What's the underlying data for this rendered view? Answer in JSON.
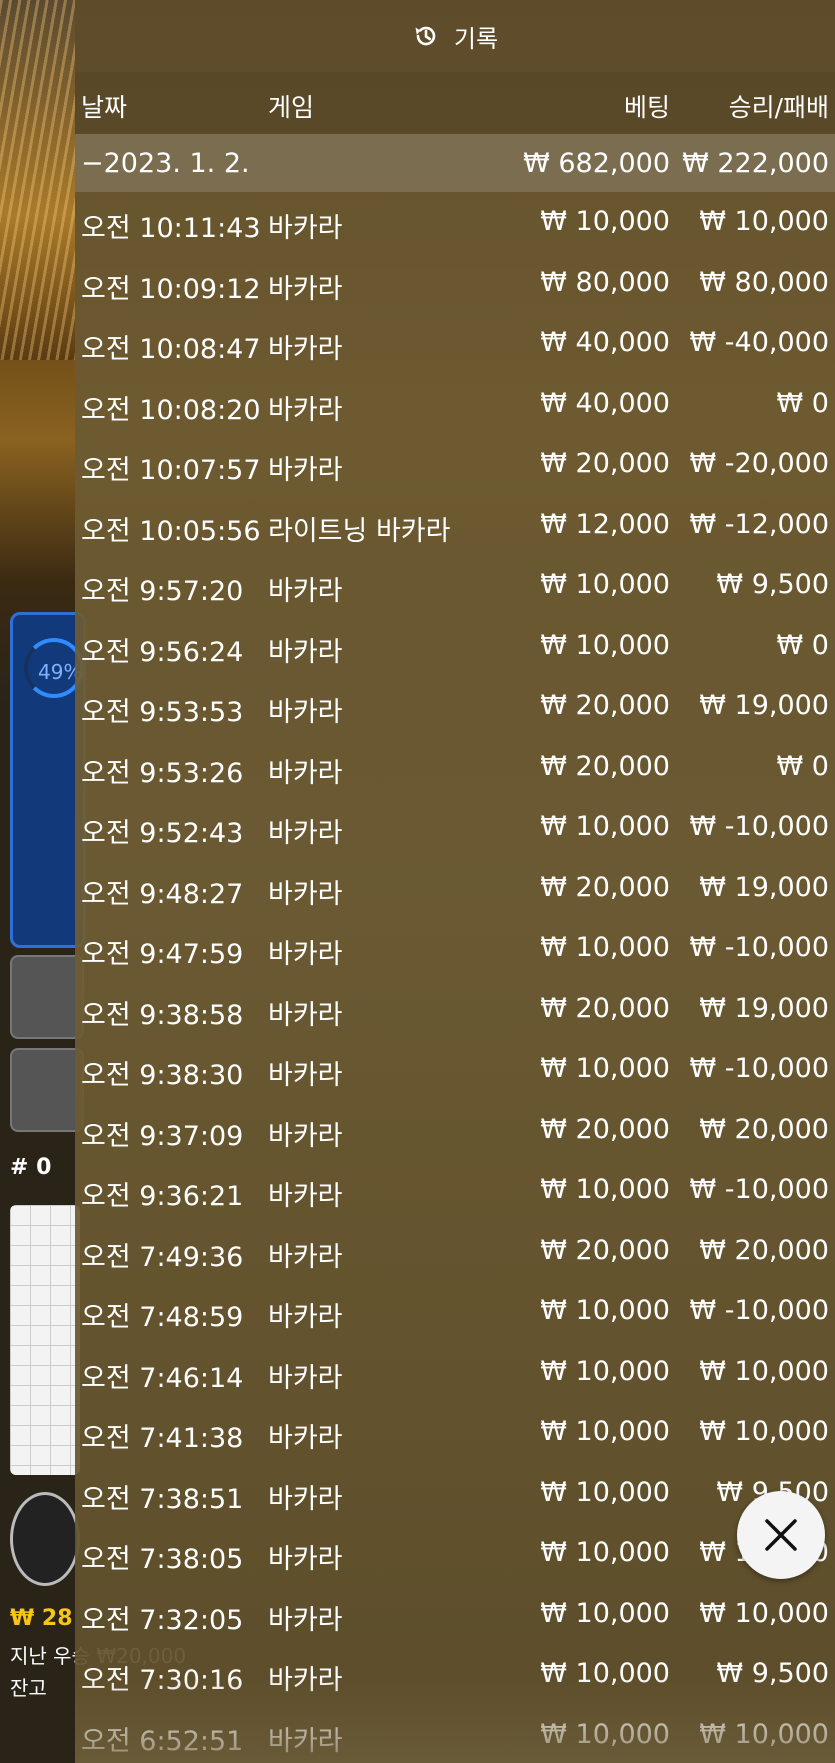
{
  "background": {
    "progress_label": "49%",
    "hash_label": "# 0",
    "balance_line1": "₩ 28",
    "balance_line2": "지난 우승 ₩20,000",
    "balance_line3": "잔고"
  },
  "panel": {
    "title": "기록",
    "icon": "history-icon",
    "columns": {
      "date": "날짜",
      "game": "게임",
      "bet": "베팅",
      "result": "승리/패배"
    },
    "summary": {
      "date": "−2023. 1. 2.",
      "bet": "₩ 682,000",
      "result": "₩ 222,000"
    },
    "rows": [
      {
        "time": "오전 10:11:43",
        "game": "바카라",
        "bet": "₩ 10,000",
        "result": "₩ 10,000"
      },
      {
        "time": "오전 10:09:12",
        "game": "바카라",
        "bet": "₩ 80,000",
        "result": "₩ 80,000"
      },
      {
        "time": "오전 10:08:47",
        "game": "바카라",
        "bet": "₩ 40,000",
        "result": "₩ -40,000"
      },
      {
        "time": "오전 10:08:20",
        "game": "바카라",
        "bet": "₩ 40,000",
        "result": "₩ 0"
      },
      {
        "time": "오전 10:07:57",
        "game": "바카라",
        "bet": "₩ 20,000",
        "result": "₩ -20,000"
      },
      {
        "time": "오전 10:05:56",
        "game": "라이트닝 바카라",
        "bet": "₩ 12,000",
        "result": "₩ -12,000"
      },
      {
        "time": "오전 9:57:20",
        "game": "바카라",
        "bet": "₩ 10,000",
        "result": "₩ 9,500"
      },
      {
        "time": "오전 9:56:24",
        "game": "바카라",
        "bet": "₩ 10,000",
        "result": "₩ 0"
      },
      {
        "time": "오전 9:53:53",
        "game": "바카라",
        "bet": "₩ 20,000",
        "result": "₩ 19,000"
      },
      {
        "time": "오전 9:53:26",
        "game": "바카라",
        "bet": "₩ 20,000",
        "result": "₩ 0"
      },
      {
        "time": "오전 9:52:43",
        "game": "바카라",
        "bet": "₩ 10,000",
        "result": "₩ -10,000"
      },
      {
        "time": "오전 9:48:27",
        "game": "바카라",
        "bet": "₩ 20,000",
        "result": "₩ 19,000"
      },
      {
        "time": "오전 9:47:59",
        "game": "바카라",
        "bet": "₩ 10,000",
        "result": "₩ -10,000"
      },
      {
        "time": "오전 9:38:58",
        "game": "바카라",
        "bet": "₩ 20,000",
        "result": "₩ 19,000"
      },
      {
        "time": "오전 9:38:30",
        "game": "바카라",
        "bet": "₩ 10,000",
        "result": "₩ -10,000"
      },
      {
        "time": "오전 9:37:09",
        "game": "바카라",
        "bet": "₩ 20,000",
        "result": "₩ 20,000"
      },
      {
        "time": "오전 9:36:21",
        "game": "바카라",
        "bet": "₩ 10,000",
        "result": "₩ -10,000"
      },
      {
        "time": "오전 7:49:36",
        "game": "바카라",
        "bet": "₩ 20,000",
        "result": "₩ 20,000"
      },
      {
        "time": "오전 7:48:59",
        "game": "바카라",
        "bet": "₩ 10,000",
        "result": "₩ -10,000"
      },
      {
        "time": "오전 7:46:14",
        "game": "바카라",
        "bet": "₩ 10,000",
        "result": "₩ 10,000"
      },
      {
        "time": "오전 7:41:38",
        "game": "바카라",
        "bet": "₩ 10,000",
        "result": "₩ 10,000"
      },
      {
        "time": "오전 7:38:51",
        "game": "바카라",
        "bet": "₩ 10,000",
        "result": "₩ 9,500"
      },
      {
        "time": "오전 7:38:05",
        "game": "바카라",
        "bet": "₩ 10,000",
        "result": "₩ 10,000"
      },
      {
        "time": "오전 7:32:05",
        "game": "바카라",
        "bet": "₩ 10,000",
        "result": "₩ 10,000"
      },
      {
        "time": "오전 7:30:16",
        "game": "바카라",
        "bet": "₩ 10,000",
        "result": "₩ 9,500"
      },
      {
        "time": "오전 6:52:51",
        "game": "바카라",
        "bet": "₩ 10,000",
        "result": "₩ 10,000"
      }
    ]
  },
  "close_button": {
    "icon": "close-icon"
  }
}
